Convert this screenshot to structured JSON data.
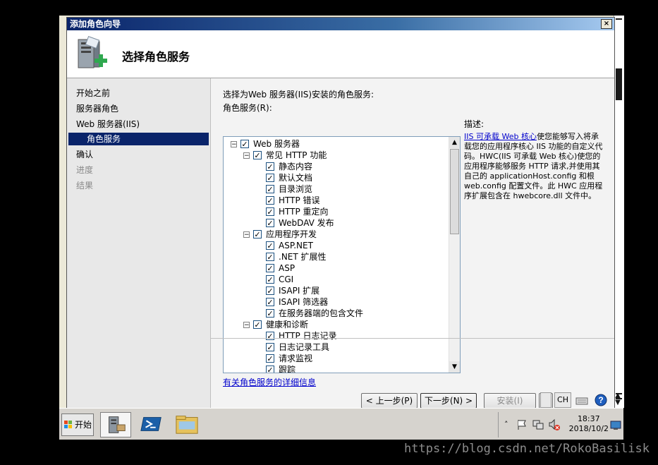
{
  "window": {
    "title": "添加角色向导",
    "header_title": "选择角色服务",
    "close_label": "×"
  },
  "sidebar": {
    "items": [
      {
        "label": "开始之前",
        "state": "normal"
      },
      {
        "label": "服务器角色",
        "state": "normal"
      },
      {
        "label": "Web 服务器(IIS)",
        "state": "normal"
      },
      {
        "label": "角色服务",
        "state": "selected"
      },
      {
        "label": "确认",
        "state": "normal"
      },
      {
        "label": "进度",
        "state": "disabled"
      },
      {
        "label": "结果",
        "state": "disabled"
      }
    ]
  },
  "content": {
    "instruction": "选择为Web 服务器(IIS)安装的角色服务:",
    "tree_label": "角色服务(R):",
    "description_label": "描述:",
    "description_link": "IIS 可承载 Web 核心",
    "description_text": "使您能够写入将承载您的应用程序核心 IIS 功能的自定义代码。HWC(IIS 可承载 Web 核心)使您的应用程序能够服务 HTTP 请求,并使用其自己的 applicationHost.config 和根 web.config 配置文件。此 HWC 应用程序扩展包含在 hwebcore.dll 文件中。",
    "more_info_link": "有关角色服务的详细信息"
  },
  "tree": [
    {
      "label": "Web 服务器",
      "level": 0,
      "expander": "−",
      "checked": true
    },
    {
      "label": "常见 HTTP 功能",
      "level": 1,
      "expander": "−",
      "checked": true
    },
    {
      "label": "静态内容",
      "level": 2,
      "checked": true
    },
    {
      "label": "默认文档",
      "level": 2,
      "checked": true
    },
    {
      "label": "目录浏览",
      "level": 2,
      "checked": true
    },
    {
      "label": "HTTP 错误",
      "level": 2,
      "checked": true
    },
    {
      "label": "HTTP 重定向",
      "level": 2,
      "checked": true
    },
    {
      "label": "WebDAV 发布",
      "level": 2,
      "checked": true
    },
    {
      "label": "应用程序开发",
      "level": 1,
      "expander": "−",
      "checked": true
    },
    {
      "label": "ASP.NET",
      "level": 2,
      "checked": true
    },
    {
      "label": ".NET 扩展性",
      "level": 2,
      "checked": true
    },
    {
      "label": "ASP",
      "level": 2,
      "checked": true
    },
    {
      "label": "CGI",
      "level": 2,
      "checked": true
    },
    {
      "label": "ISAPI 扩展",
      "level": 2,
      "checked": true
    },
    {
      "label": "ISAPI 筛选器",
      "level": 2,
      "checked": true
    },
    {
      "label": "在服务器端的包含文件",
      "level": 2,
      "checked": true
    },
    {
      "label": "健康和诊断",
      "level": 1,
      "expander": "−",
      "checked": true
    },
    {
      "label": "HTTP 日志记录",
      "level": 2,
      "checked": true
    },
    {
      "label": "日志记录工具",
      "level": 2,
      "checked": true
    },
    {
      "label": "请求监视",
      "level": 2,
      "checked": true
    },
    {
      "label": "跟踪",
      "level": 2,
      "checked": true
    }
  ],
  "buttons": {
    "prev": "< 上一步(P)",
    "next": "下一步(N) >",
    "install": "安装(I)",
    "cancel": ""
  },
  "taskbar": {
    "start_label": "开始",
    "language": "CH",
    "time": "18:37",
    "date": "2018/10/2"
  },
  "watermark": "https://blog.csdn.net/RokoBasilisk",
  "colors": {
    "selected": "#0a246a",
    "link": "#0000cc",
    "title_gradient_start": "#0a246a"
  }
}
